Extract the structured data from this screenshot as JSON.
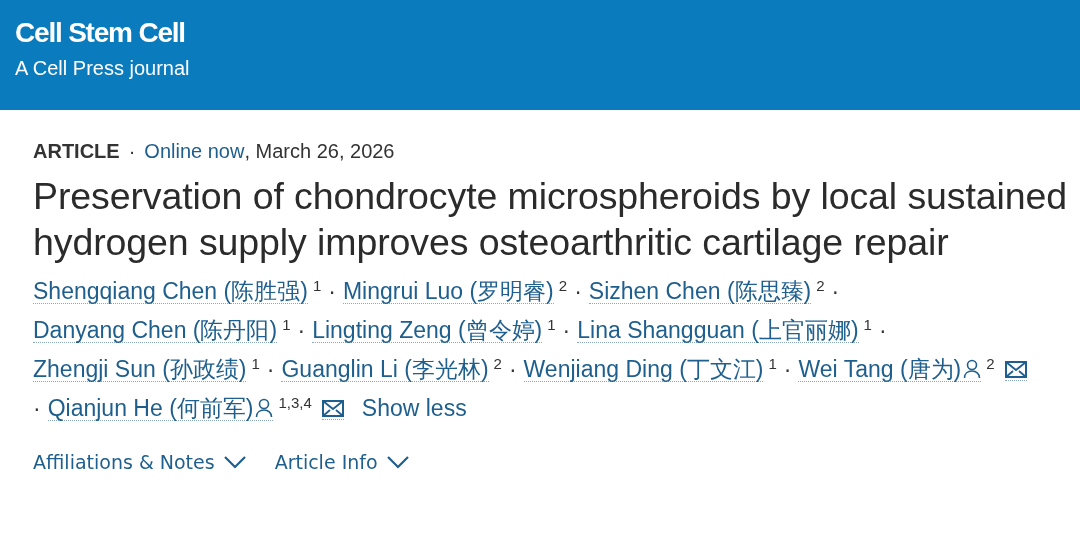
{
  "header": {
    "journal": "Cell Stem Cell",
    "tagline": "A Cell Press journal"
  },
  "meta": {
    "type": "ARTICLE",
    "separator": "·",
    "status": "Online now",
    "date": ", March 26, 2026"
  },
  "title": "Preservation of chondrocyte microspheroids by local sustained hydrogen supply improves osteoarthritic cartilage repair",
  "author_lines": [
    [
      {
        "name": "Shengqiang Chen (陈胜强)",
        "sup": "1",
        "corresponding": false,
        "trail": "·"
      },
      {
        "name": "Mingrui Luo (罗明睿)",
        "sup": "2",
        "corresponding": false,
        "trail": "·"
      },
      {
        "name": "Sizhen Chen (陈思臻)",
        "sup": "2",
        "corresponding": false,
        "trail": "·"
      }
    ],
    [
      {
        "name": "Danyang Chen (陈丹阳)",
        "sup": "1",
        "corresponding": false,
        "trail": "·"
      },
      {
        "name": "Lingting Zeng (曾令婷)",
        "sup": "1",
        "corresponding": false,
        "trail": "·"
      },
      {
        "name": "Lina Shangguan (上官丽娜)",
        "sup": "1",
        "corresponding": false,
        "trail": "·"
      }
    ],
    [
      {
        "name": "Zhengji Sun (孙政绩)",
        "sup": "1",
        "corresponding": false,
        "trail": "·"
      },
      {
        "name": "Guanglin Li (李光林)",
        "sup": "2",
        "corresponding": false,
        "trail": "·"
      },
      {
        "name": "Wenjiang Ding (丁文江)",
        "sup": "1",
        "corresponding": false,
        "trail": "·"
      },
      {
        "name": "Wei Tang (唐为)",
        "sup": "2",
        "corresponding": true
      }
    ],
    [
      {
        "lead": "·",
        "name": "Qianjun He (何前军)",
        "sup": "1,3,4",
        "corresponding": true
      }
    ]
  ],
  "show_less": "Show less",
  "sections": [
    {
      "label": "Affiliations & Notes",
      "expanded": false
    },
    {
      "label": "Article Info",
      "expanded": false
    }
  ]
}
